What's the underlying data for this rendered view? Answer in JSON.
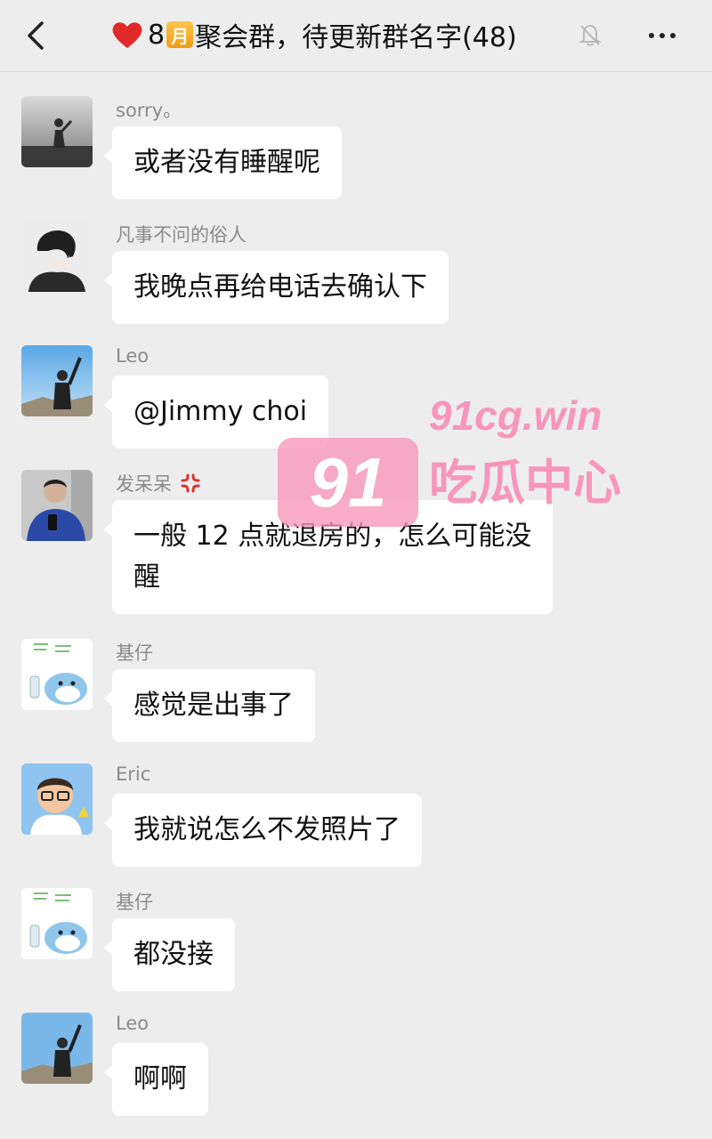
{
  "header": {
    "title_prefix": "8",
    "title_month": "月",
    "title_suffix": "聚会群，待更新群名字(48)"
  },
  "messages": [
    {
      "sender": "sorry。",
      "text": "或者没有睡醒呢"
    },
    {
      "sender": "凡事不问的俗人",
      "text": "我晚点再给电话去确认下"
    },
    {
      "sender": "Leo",
      "text": "@Jimmy choi"
    },
    {
      "sender": "发呆呆",
      "text_line1": "一般 12 点就退房的，怎么可能没",
      "text_line2": "醒"
    },
    {
      "sender": "基仔",
      "text": "感觉是出事了"
    },
    {
      "sender": "Eric",
      "text": "我就说怎么不发照片了"
    },
    {
      "sender": "基仔",
      "text": "都没接"
    },
    {
      "sender": "Leo",
      "text": "啊啊"
    }
  ],
  "watermark": {
    "badge": "91",
    "url": "91cg.win",
    "name": "吃瓜中心"
  },
  "colors": {
    "background": "#ededed",
    "bubble": "#ffffff",
    "sender_name": "#8a8a8a",
    "heart": "#e02a2a",
    "month_badge": "#f29b13",
    "watermark": "#f78cb4"
  },
  "icons": [
    "back-arrow-icon",
    "heart-icon",
    "mute-bell-icon",
    "more-dots-icon",
    "anger-icon"
  ]
}
